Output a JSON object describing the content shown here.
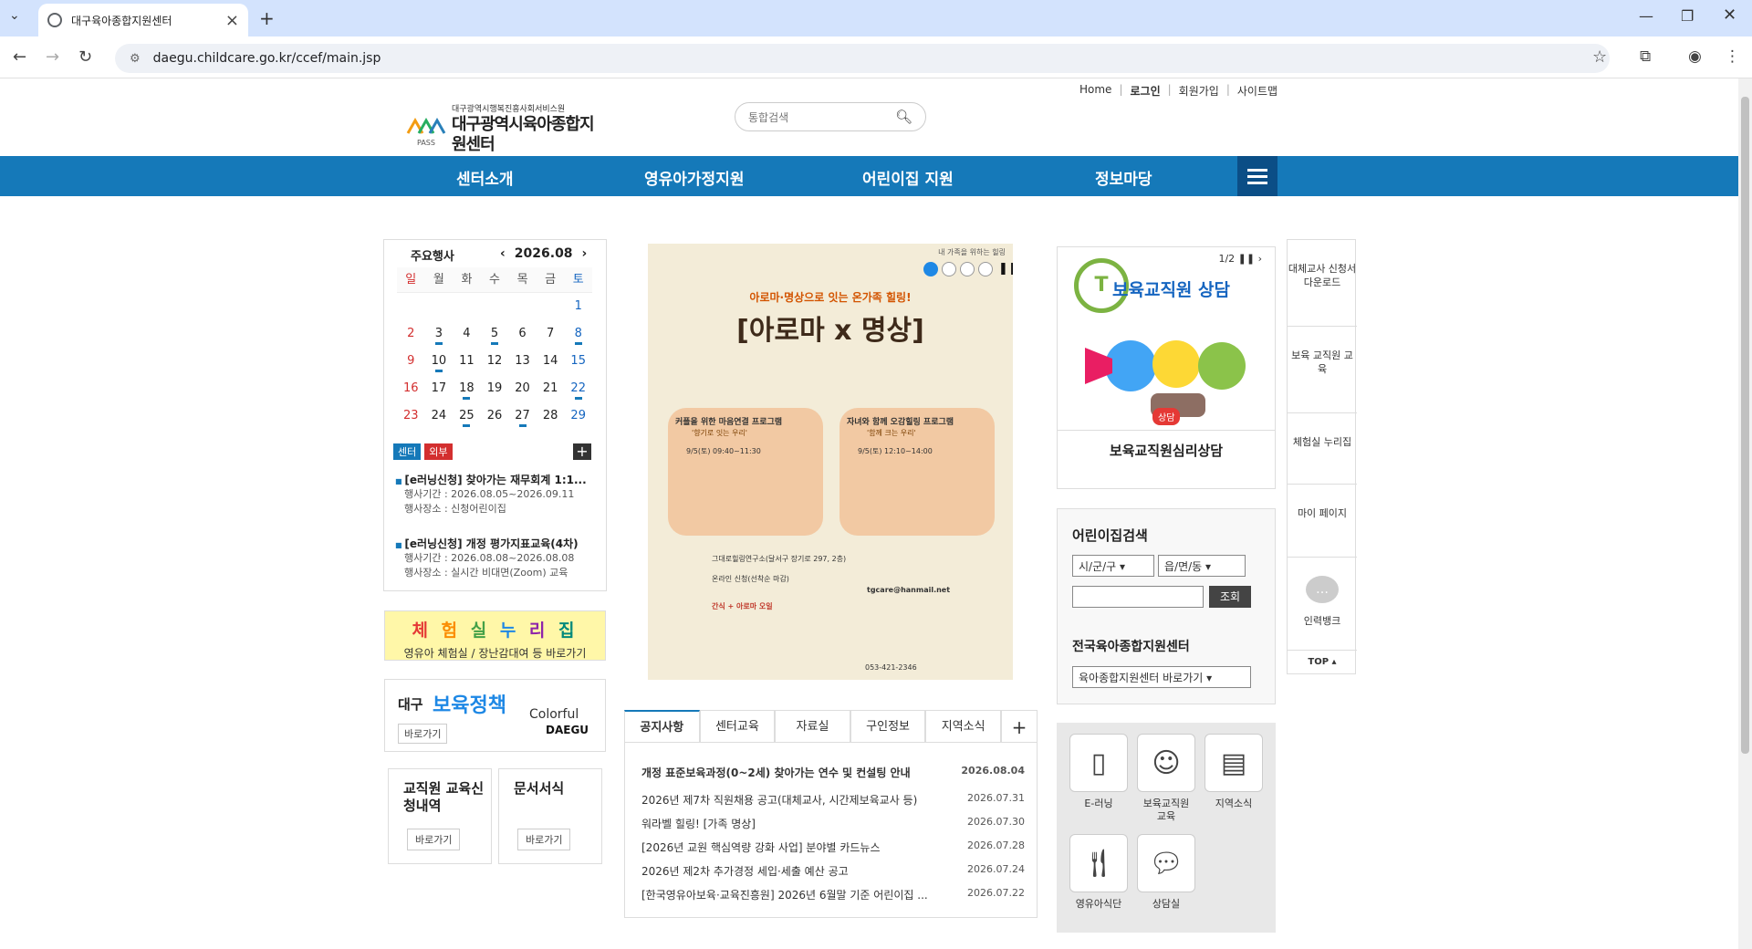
{
  "browser": {
    "tab_title": "대구육아종합지원센터",
    "url": "daegu.childcare.go.kr/ccef/main.jsp"
  },
  "util": {
    "home": "Home",
    "login": "로그인",
    "join": "회원가입",
    "sitemap": "사이트맵"
  },
  "logo": {
    "sub": "대구광역시행복진흥사회서비스원",
    "main": "대구광역시육아종합지원센터",
    "pass": "PASS"
  },
  "search": {
    "placeholder": "통합검색"
  },
  "gnb": [
    "센터소개",
    "영유아가정지원",
    "어린이집 지원",
    "정보마당"
  ],
  "calendar": {
    "title": "주요행사",
    "month": "2026.08",
    "dow": [
      "일",
      "월",
      "화",
      "수",
      "목",
      "금",
      "토"
    ],
    "weeks": [
      [
        "",
        "",
        "",
        "",
        "",
        "",
        "1"
      ],
      [
        "2",
        "3",
        "4",
        "5",
        "6",
        "7",
        "8"
      ],
      [
        "9",
        "10",
        "11",
        "12",
        "13",
        "14",
        "15"
      ],
      [
        "16",
        "17",
        "18",
        "19",
        "20",
        "21",
        "22"
      ],
      [
        "23",
        "24",
        "25",
        "26",
        "27",
        "28",
        "29"
      ]
    ],
    "events_days": [
      "3",
      "5",
      "8",
      "10",
      "18",
      "22",
      "25",
      "27"
    ],
    "badge_center": "센터",
    "badge_external": "외부",
    "events": [
      {
        "title": "[e러닝신청] 찾아가는 재무회계 1:1...",
        "period": "행사기간 : 2026.08.05~2026.09.11",
        "place": "행사장소 : 신청어린이집"
      },
      {
        "title": "[e러닝신청] 개정 평가지표교육(4차)",
        "period": "행사기간 : 2026.08.08~2026.08.08",
        "place": "행사장소 : 실시간 비대면(Zoom) 교육"
      }
    ]
  },
  "banner1": {
    "title": "체 험 실 누 리 집",
    "sub": "영유아 체험실 / 장난감대여 등 바로가기"
  },
  "banner2": {
    "a": "대구",
    "b": "보육정책",
    "go": "바로가기",
    "brand1": "Colorful",
    "brand2": "DAEGU"
  },
  "box3": {
    "title": "교직원 교육신청내역",
    "go": "바로가기"
  },
  "box4": {
    "title": "문서서식",
    "go": "바로가기"
  },
  "poster": {
    "top": "내 가족을 위하는 힐링",
    "subtitle": "아로마·명상으로 잇는 온가족 힐링!",
    "title": "[아로마 x 명상]",
    "p1": "커플을 위한 마음연결 프로그램",
    "p1s": "'향기로 잇는 우리'",
    "p1t": "9/5(토) 09:40~11:30",
    "p2": "자녀와 함께 오감힐링 프로그램",
    "p2s": "'함께 크는 우리'",
    "p2t": "9/5(토) 12:10~14:00",
    "place": "그대로힐링연구소(달서구 장기로 297, 2층)",
    "apply": "온라인 신청(선착순 마감)",
    "email": "tgcare@hanmail.net",
    "gift": "간식 + 아로마 오일",
    "tel": "053-421-2346"
  },
  "notice": {
    "tabs": [
      "공지사항",
      "센터교육",
      "자료실",
      "구인정보",
      "지역소식"
    ],
    "plus": "+",
    "items": [
      {
        "title": "개정 표준보육과정(0~2세) 찾아가는 연수 및 컨설팅 안내",
        "date": "2026.08.04",
        "bold": true
      },
      {
        "title": "2026년 제7차 직원채용 공고(대체교사, 시간제보육교사 등)",
        "date": "2026.07.31"
      },
      {
        "title": "워라벨 힐링! [가족 명상]",
        "date": "2026.07.30"
      },
      {
        "title": "[2026년 교원 핵심역량 강화 사업] 분야별 카드뉴스",
        "date": "2026.07.28"
      },
      {
        "title": "2026년 제2차 추가경정 세입·세출 예산 공고",
        "date": "2026.07.24"
      },
      {
        "title": "[한국영유아보육·교육진흥원] 2026년 6월말 기준 어린이집 ...",
        "date": "2026.07.22"
      }
    ]
  },
  "counsel": {
    "page": "1/2",
    "head": "보육교직원 상담",
    "caption": "보육교직원심리상담",
    "badge": "상담"
  },
  "find": {
    "title": "어린이집검색",
    "sel1": "시/군/구",
    "sel2": "읍/면/동",
    "btn": "조회",
    "title2": "전국육아종합지원센터",
    "sel3": "육아종합지원센터 바로가기"
  },
  "icons": [
    {
      "label": "E-러닝",
      "icon": "mobile-icon"
    },
    {
      "label": "보육교직원 교육",
      "icon": "teacher-icon"
    },
    {
      "label": "지역소식",
      "icon": "news-icon"
    },
    {
      "label": "영유아식단",
      "icon": "utensils-icon"
    },
    {
      "label": "상담실",
      "icon": "chat-icon"
    }
  ],
  "quick": [
    {
      "label": "대체교사 신청서 다운로드"
    },
    {
      "label": "보육 교직원 교육"
    },
    {
      "label": "체험실 누리집"
    },
    {
      "label": "마이 페이지"
    },
    {
      "label": "인력뱅크"
    }
  ],
  "quick_top": "TOP",
  "colors": {
    "primary": "#1579b9",
    "navy": "#0b4e86",
    "red": "#d32f2f"
  }
}
